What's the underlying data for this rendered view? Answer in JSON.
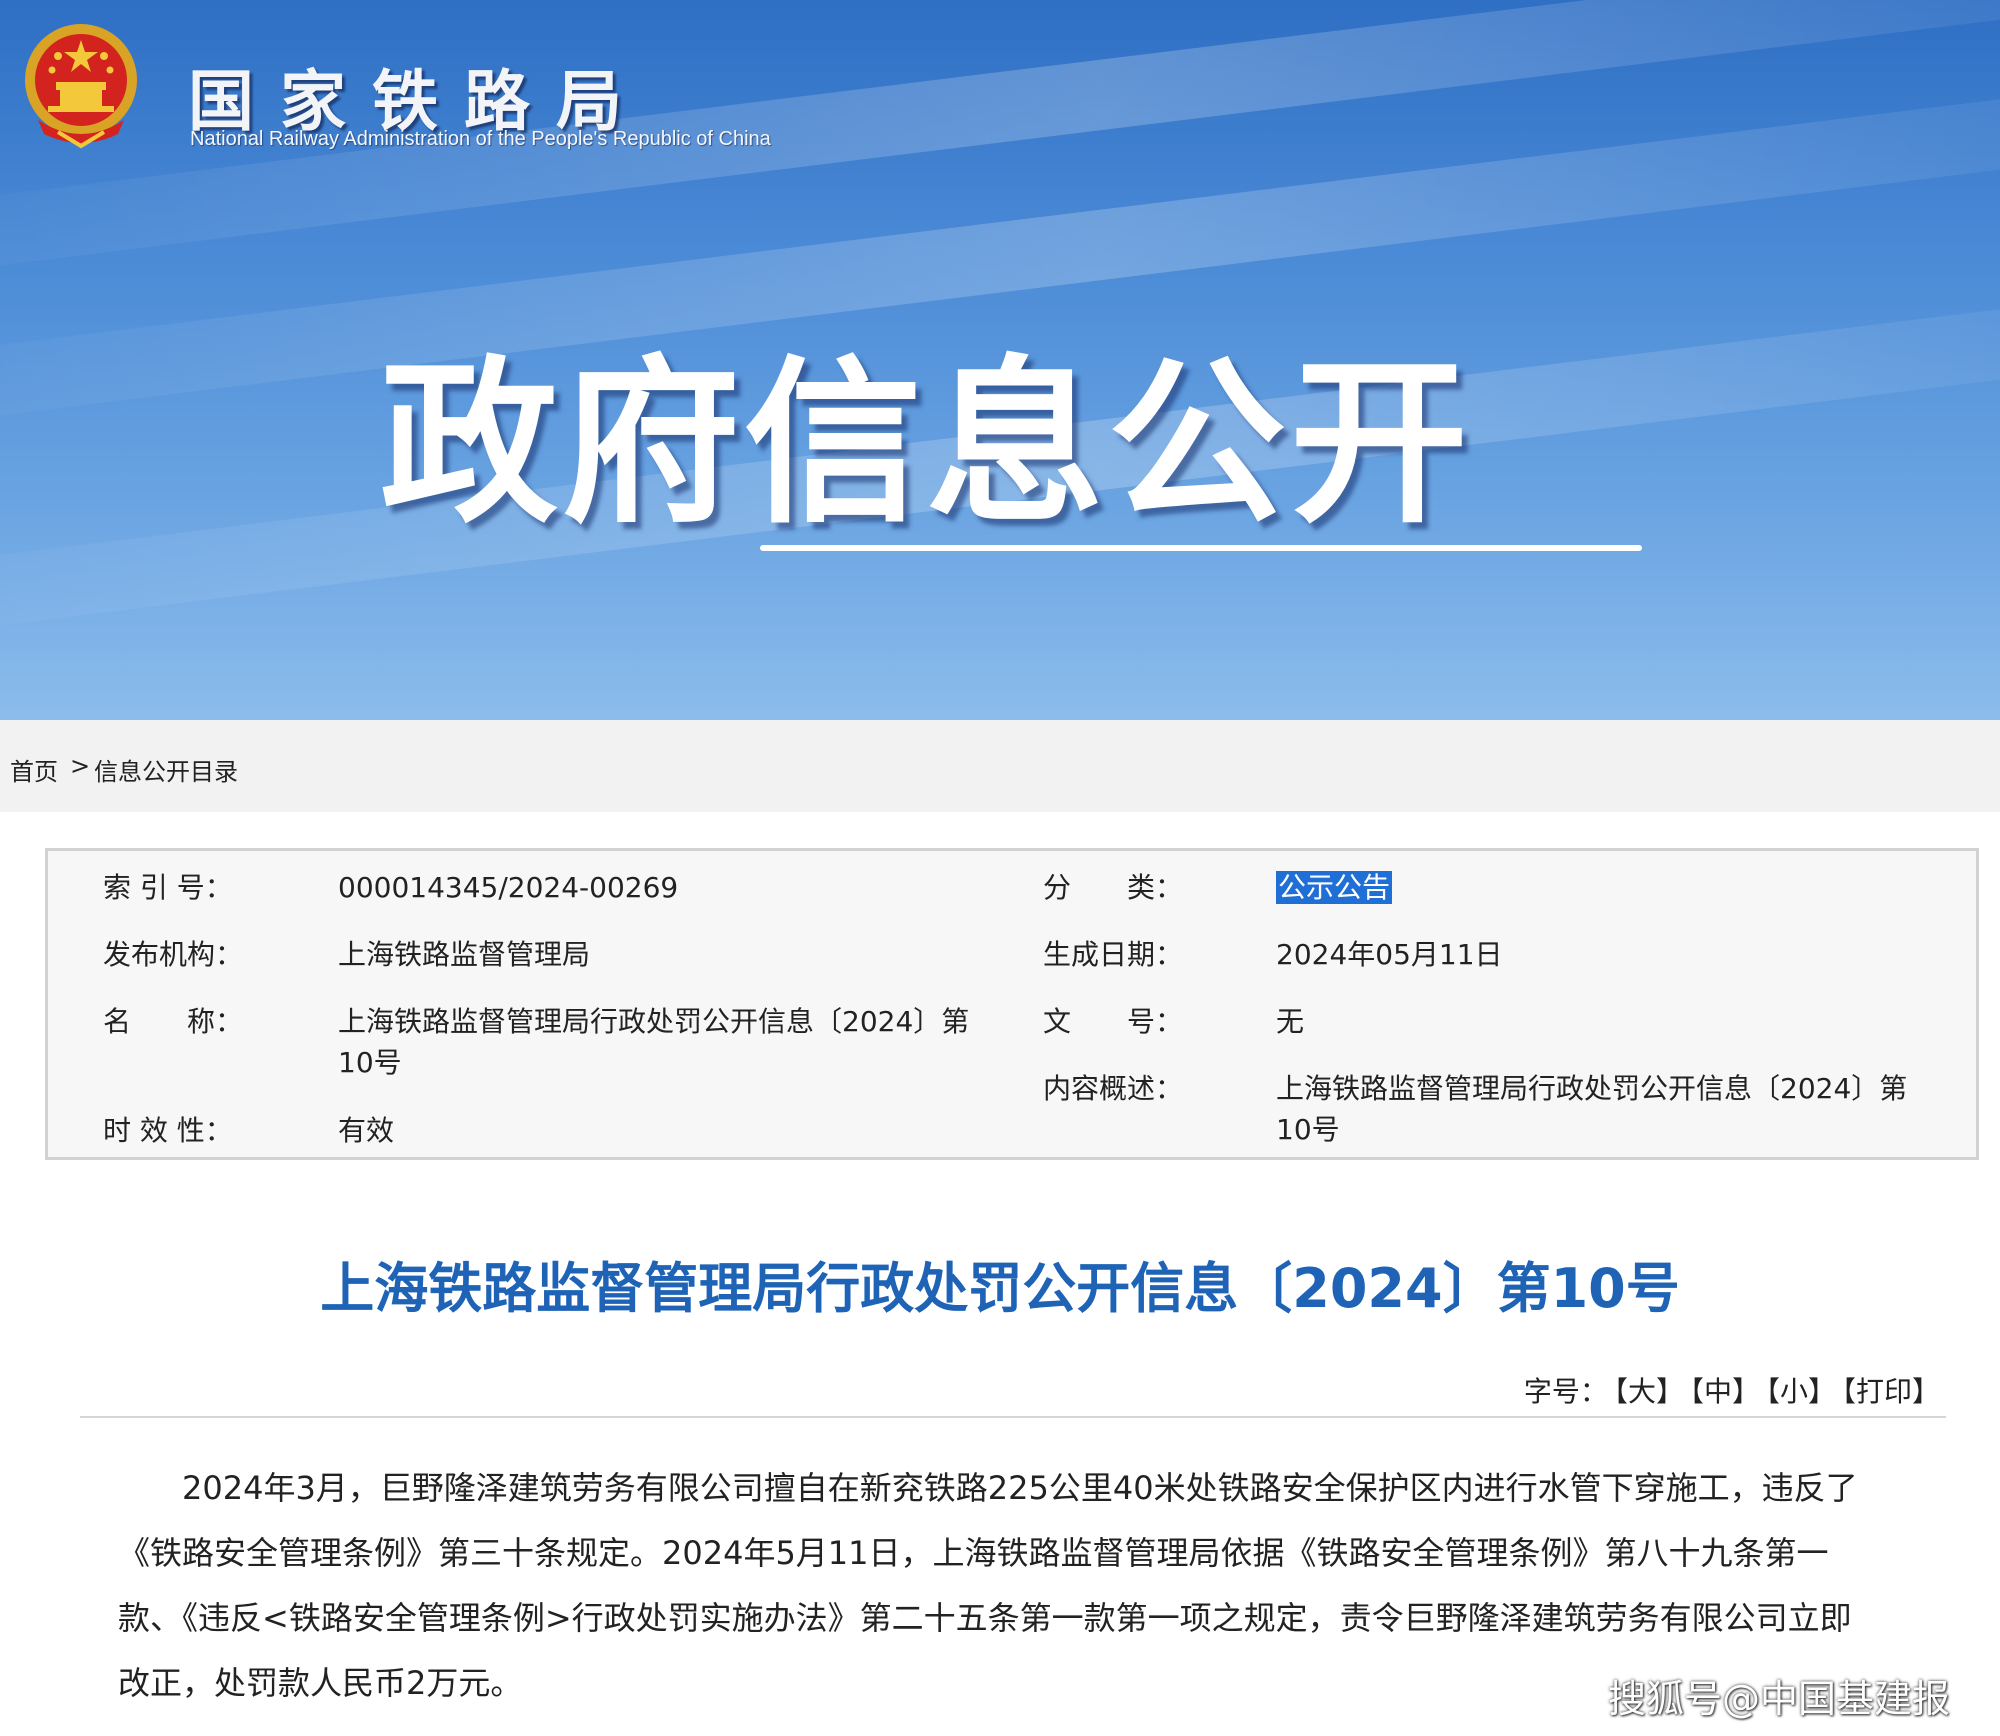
{
  "header": {
    "brand_cn": "国家铁路局",
    "brand_en": "National Railway Administration of the People's Republic of China",
    "banner_title": "政府信息公开"
  },
  "breadcrumb": {
    "home": "首页",
    "separator": ">",
    "current": "信息公开目录"
  },
  "meta": {
    "index_label": "索 引 号：",
    "index_value": "000014345/2024-00269",
    "category_label": "分　　类：",
    "category_value": "公示公告",
    "publisher_label": "发布机构：",
    "publisher_value": "上海铁路监督管理局",
    "date_label": "生成日期：",
    "date_value": "2024年05月11日",
    "name_label": "名　　称：",
    "name_value_line1": "上海铁路监督管理局行政处罚公开信息〔2024〕第",
    "name_value_line2": "10号",
    "docno_label": "文　　号：",
    "docno_value": "无",
    "summary_label": "内容概述：",
    "summary_value_line1": "上海铁路监督管理局行政处罚公开信息〔2024〕第",
    "summary_value_line2": "10号",
    "validity_label": "时 效 性：",
    "validity_value": "有效"
  },
  "article": {
    "title": "上海铁路监督管理局行政处罚公开信息〔2024〕第10号",
    "font_size_label": "字号：",
    "font_large": "【大】",
    "font_medium": "【中】",
    "font_small": "【小】",
    "print": "【打印】",
    "body_lines": [
      "2024年3月，巨野隆泽建筑劳务有限公司擅自在新兖铁路225公里40米处铁路安全保护区内进行水管下穿施工，违反了",
      "《铁路安全管理条例》第三十条规定。2024年5月11日，上海铁路监督管理局依据《铁路安全管理条例》第八十九条第一",
      "款、《违反<铁路安全管理条例>行政处罚实施办法》第二十五条第一款第一项之规定，责令巨野隆泽建筑劳务有限公司立即",
      "改正，处罚款人民币2万元。"
    ]
  },
  "watermark": "搜狐号@中国基建报",
  "colors": {
    "title_blue": "#1e63b6",
    "highlight": "#1f6fd6",
    "banner_top": "#2f6fc4"
  },
  "icons": {
    "emblem": "national-emblem-icon"
  }
}
